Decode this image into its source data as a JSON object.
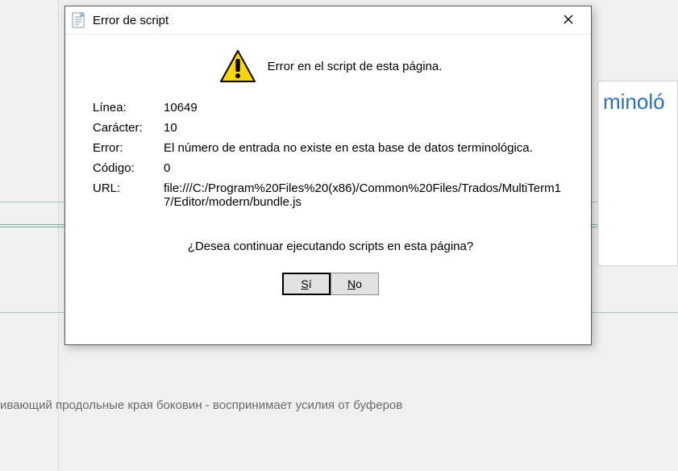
{
  "background": {
    "panel_fragment": "minoló",
    "bottom_text": "ивающий продольные края боковин - воспринимает усилия от буферов"
  },
  "dialog": {
    "title": "Error de script",
    "hero": "Error en el script de esta página.",
    "labels": {
      "line": "Línea:",
      "char": "Carácter:",
      "error": "Error:",
      "code": "Código:",
      "url": "URL:"
    },
    "values": {
      "line": "10649",
      "char": "10",
      "error": "El número de entrada no existe en esta base de datos terminológica.",
      "code": "0",
      "url": "file:///C:/Program%20Files%20(x86)/Common%20Files/Trados/MultiTerm17/Editor/modern/bundle.js"
    },
    "question": "¿Desea continuar ejecutando scripts en esta página?",
    "buttons": {
      "yes_full": "Sí",
      "yes_accel": "S",
      "yes_rest": "í",
      "no_full": "No",
      "no_accel": "N",
      "no_rest": "o"
    }
  }
}
